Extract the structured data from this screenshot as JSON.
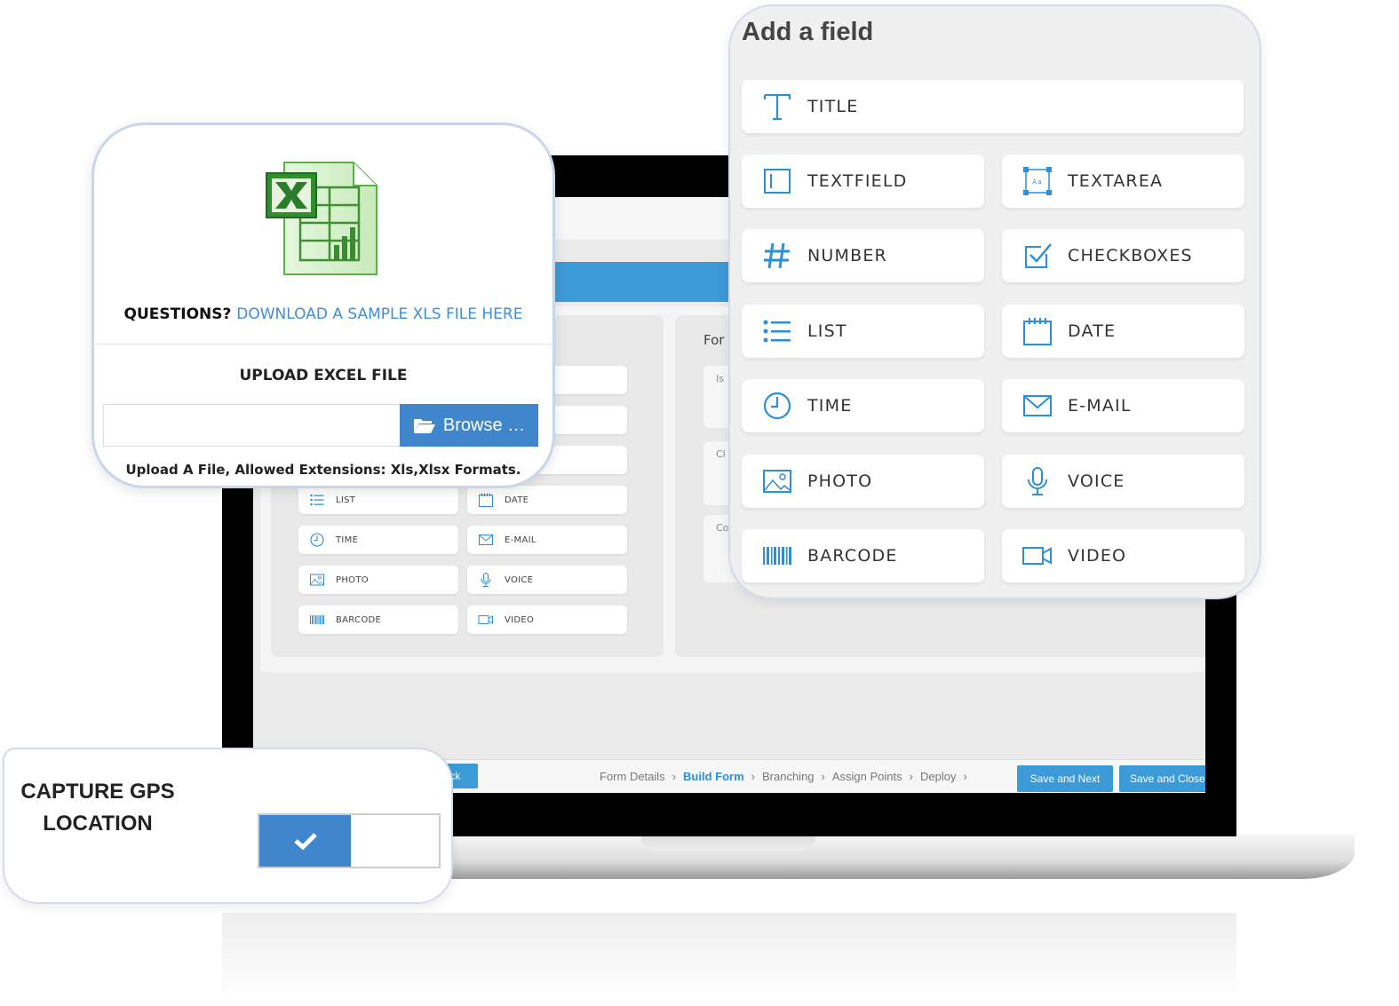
{
  "laptop": {
    "right_panel_title": "For",
    "right_panel_fields": [
      "Is",
      "Cl",
      "Co"
    ],
    "small_fields": [
      {
        "label": "",
        "icon": "none"
      },
      {
        "label": "",
        "icon": "none"
      },
      {
        "label": "",
        "icon": "none"
      },
      {
        "label": "",
        "icon": "none"
      },
      {
        "label": "",
        "icon": "none"
      },
      {
        "label": "OXES",
        "icon": "none"
      },
      {
        "label": "LIST",
        "icon": "list-icon"
      },
      {
        "label": "DATE",
        "icon": "calendar-icon"
      },
      {
        "label": "TIME",
        "icon": "clock-icon"
      },
      {
        "label": "E-MAIL",
        "icon": "mail-icon"
      },
      {
        "label": "PHOTO",
        "icon": "image-icon"
      },
      {
        "label": "VOICE",
        "icon": "microphone-icon"
      },
      {
        "label": "BARCODE",
        "icon": "barcode-icon"
      },
      {
        "label": "VIDEO",
        "icon": "video-icon"
      }
    ],
    "back_label": "ack",
    "breadcrumb": [
      {
        "label": "Form Details",
        "active": false
      },
      {
        "label": "Build Form",
        "active": true
      },
      {
        "label": "Branching",
        "active": false
      },
      {
        "label": "Assign Points",
        "active": false
      },
      {
        "label": "Deploy",
        "active": false
      }
    ],
    "breadcrumb_separator": "›",
    "save_next_label": "Save and Next",
    "save_close_label": "Save and Close"
  },
  "add_field": {
    "title": "Add a field",
    "title_field": {
      "label": "TITLE",
      "icon": "text-t-icon"
    },
    "fields": [
      {
        "label": "TEXTFIELD",
        "icon": "textfield-icon"
      },
      {
        "label": "TEXTAREA",
        "icon": "textarea-icon"
      },
      {
        "label": "NUMBER",
        "icon": "hash-icon"
      },
      {
        "label": "CHECKBOXES",
        "icon": "checkbox-icon"
      },
      {
        "label": "LIST",
        "icon": "list-icon"
      },
      {
        "label": "DATE",
        "icon": "calendar-icon"
      },
      {
        "label": "TIME",
        "icon": "clock-icon"
      },
      {
        "label": "E-MAIL",
        "icon": "mail-icon"
      },
      {
        "label": "PHOTO",
        "icon": "image-icon"
      },
      {
        "label": "VOICE",
        "icon": "microphone-icon"
      },
      {
        "label": "BARCODE",
        "icon": "barcode-icon"
      },
      {
        "label": "VIDEO",
        "icon": "video-icon"
      }
    ]
  },
  "excel_upload": {
    "questions_label": "QUESTIONS?",
    "download_link": "DOWNLOAD A SAMPLE XLS FILE HERE",
    "upload_title": "UPLOAD EXCEL FILE",
    "file_value": "",
    "browse_label": "Browse …",
    "hint": "Upload A File, Allowed Extensions: Xls,Xlsx Formats."
  },
  "gps": {
    "label": "CAPTURE GPS LOCATION",
    "enabled": true
  },
  "colors": {
    "accent": "#3c9ad6",
    "browse": "#3f86cc",
    "icon": "#2d8fd5"
  }
}
